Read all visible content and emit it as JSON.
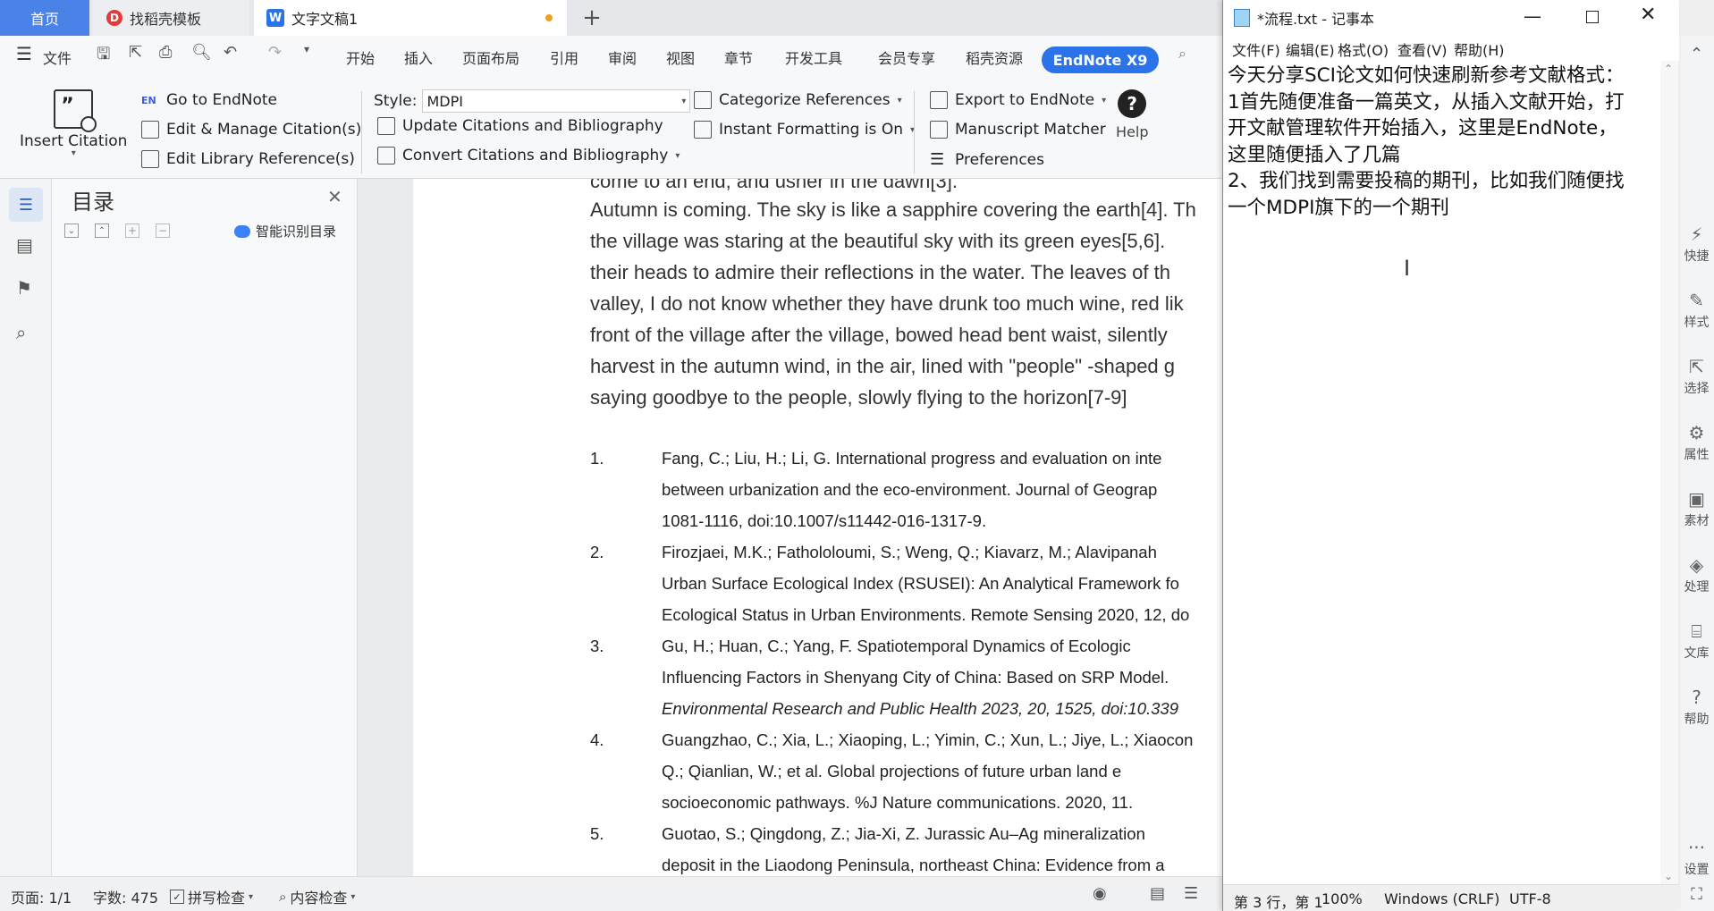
{
  "tabs": {
    "home": "首页",
    "template": "找稻壳模板",
    "doc": "文字文稿1",
    "new_tab": "+"
  },
  "menubar": {
    "file": "文件",
    "items": [
      "开始",
      "插入",
      "页面布局",
      "引用",
      "审阅",
      "视图",
      "章节",
      "开发工具",
      "会员专享",
      "稻壳资源"
    ],
    "endnote": "EndNote X9",
    "search": "查找"
  },
  "ribbon": {
    "insert_citation": "Insert Citation",
    "go_to_endnote": "Go to EndNote",
    "edit_manage": "Edit & Manage Citation(s)",
    "edit_library": "Edit Library Reference(s)",
    "style_label": "Style:",
    "style_value": "MDPI",
    "update_citations": "Update Citations and Bibliography",
    "convert_citations": "Convert Citations and Bibliography",
    "categorize": "Categorize References",
    "instant_formatting": "Instant Formatting is On",
    "export": "Export to EndNote",
    "manuscript": "Manuscript Matcher",
    "preferences": "Preferences",
    "help": "Help"
  },
  "toc": {
    "title": "目录",
    "smart_toc": "智能识别目录"
  },
  "document": {
    "body_lines": [
      "come to an end, and usher in the dawn[3].",
      "Autumn is coming. The sky is like a sapphire covering the earth[4]. Th",
      "the village was staring at the beautiful sky with its green eyes[5,6].",
      "their heads to admire their reflections in the water. The leaves of th",
      "valley, I do not know whether they have drunk too much wine, red lik",
      "front of the village after the village, bowed head bent waist, silently",
      "harvest in the autumn wind, in the air, lined with \"people\" -shaped g",
      "saying goodbye to the people, slowly flying to the horizon[7-9]"
    ],
    "references": [
      {
        "num": "1.",
        "lines": [
          "Fang, C.; Liu, H.; Li, G. International progress and evaluation on inte",
          "between urbanization and the eco-environment. Journal of Geograp",
          "1081-1116, doi:10.1007/s11442-016-1317-9."
        ]
      },
      {
        "num": "2.",
        "lines": [
          "Firozjaei, M.K.; Fathololoumi, S.; Weng, Q.; Kiavarz, M.; Alavipanah",
          "Urban Surface Ecological Index (RSUSEI): An Analytical Framework fo",
          "Ecological Status in Urban Environments. Remote Sensing 2020, 12, do"
        ]
      },
      {
        "num": "3.",
        "lines": [
          "Gu, H.; Huan, C.; Yang, F. Spatiotemporal Dynamics of Ecologic",
          "Influencing Factors in Shenyang City of China: Based on SRP Model.",
          "Environmental Research and Public Health 2023, 20, 1525, doi:10.339"
        ]
      },
      {
        "num": "4.",
        "lines": [
          "Guangzhao, C.; Xia, L.; Xiaoping, L.; Yimin, C.; Xun, L.; Jiye, L.; Xiaocon",
          "Q.; Qianlian, W.; et al. Global projections of future urban land e",
          "socioeconomic pathways. %J Nature communications. 2020, 11."
        ]
      },
      {
        "num": "5.",
        "lines": [
          "Guotao, S.; Qingdong, Z.; Jia-Xi, Z. Jurassic Au–Ag mineralization",
          "deposit in the Liaodong Peninsula, northeast China: Evidence from a"
        ]
      }
    ]
  },
  "statusbar": {
    "page": "页面: 1/1",
    "words": "字数: 475",
    "spell": "拼写检查",
    "content_check": "内容检查"
  },
  "rightbar": [
    "快捷",
    "样式",
    "选择",
    "属性",
    "素材",
    "处理",
    "文库",
    "帮助",
    "设置"
  ],
  "notepad": {
    "title": "*流程.txt - 记事本",
    "menu": [
      "文件(F)",
      "编辑(E)",
      "格式(O)",
      "查看(V)",
      "帮助(H)"
    ],
    "text": "今天分享SCI论文如何快速刷新参考文献格式：\n1首先随便准备一篇英文，从插入文献开始，打\n开文献管理软件开始插入，这里是EndNote，\n这里随便插入了几篇\n2、我们找到需要投稿的期刊，比如我们随便找\n一个MDPI旗下的一个期刊",
    "status_pos": "第 3 行，第 1",
    "status_zoom": "100%",
    "status_eol": "Windows (CRLF)",
    "status_enc": "UTF-8"
  },
  "colors": {
    "accent": "#4a82e8",
    "endnote": "#2b73e8"
  }
}
